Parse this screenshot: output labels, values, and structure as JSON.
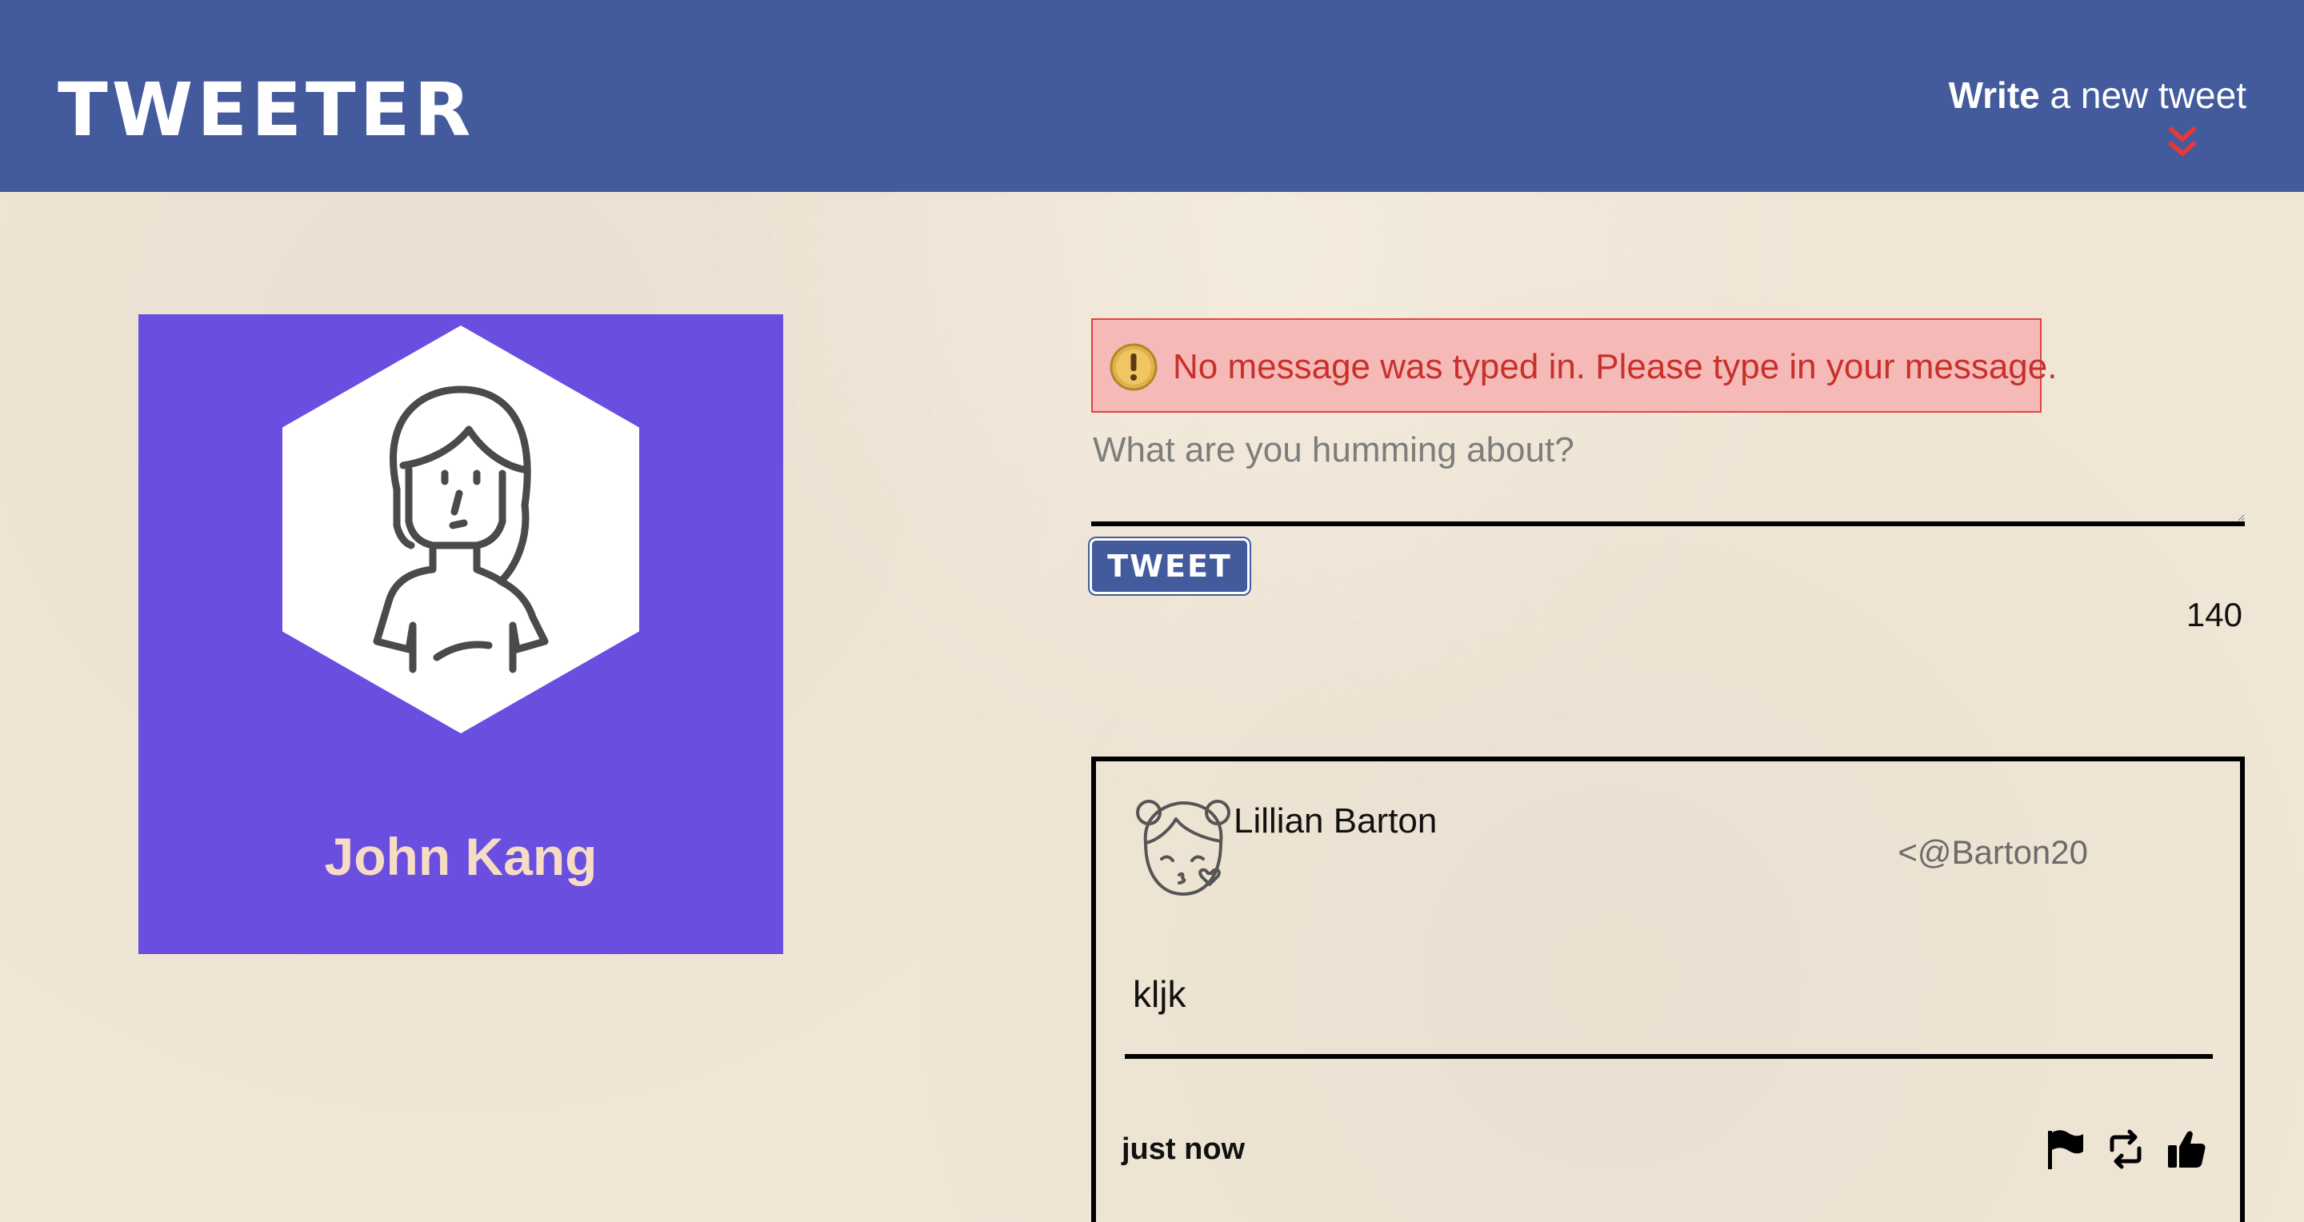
{
  "nav": {
    "logo": "TWEETER",
    "compose_bold": "Write",
    "compose_rest": " a new tweet",
    "compose_arrow_icon": "double-chevron-down-icon",
    "brand_color": "#435a9c",
    "arrow_color": "#e23a3a"
  },
  "profile": {
    "name": "John Kang",
    "avatar_icon": "woman-avatar-icon",
    "card_color": "#6a4ee0"
  },
  "composer": {
    "error_icon": "warning-icon",
    "error_message": "No message was typed in. Please type in your message.",
    "placeholder": "What are you humming about?",
    "value": "",
    "button_label": "TWEET",
    "char_counter": "140"
  },
  "tweets": [
    {
      "avatar_icon": "girl-kiss-avatar-icon",
      "name": "Lillian Barton",
      "handle": "<@Barton20",
      "content": "kljk",
      "time": "just now",
      "actions": [
        "flag-icon",
        "retweet-icon",
        "like-icon"
      ]
    }
  ]
}
